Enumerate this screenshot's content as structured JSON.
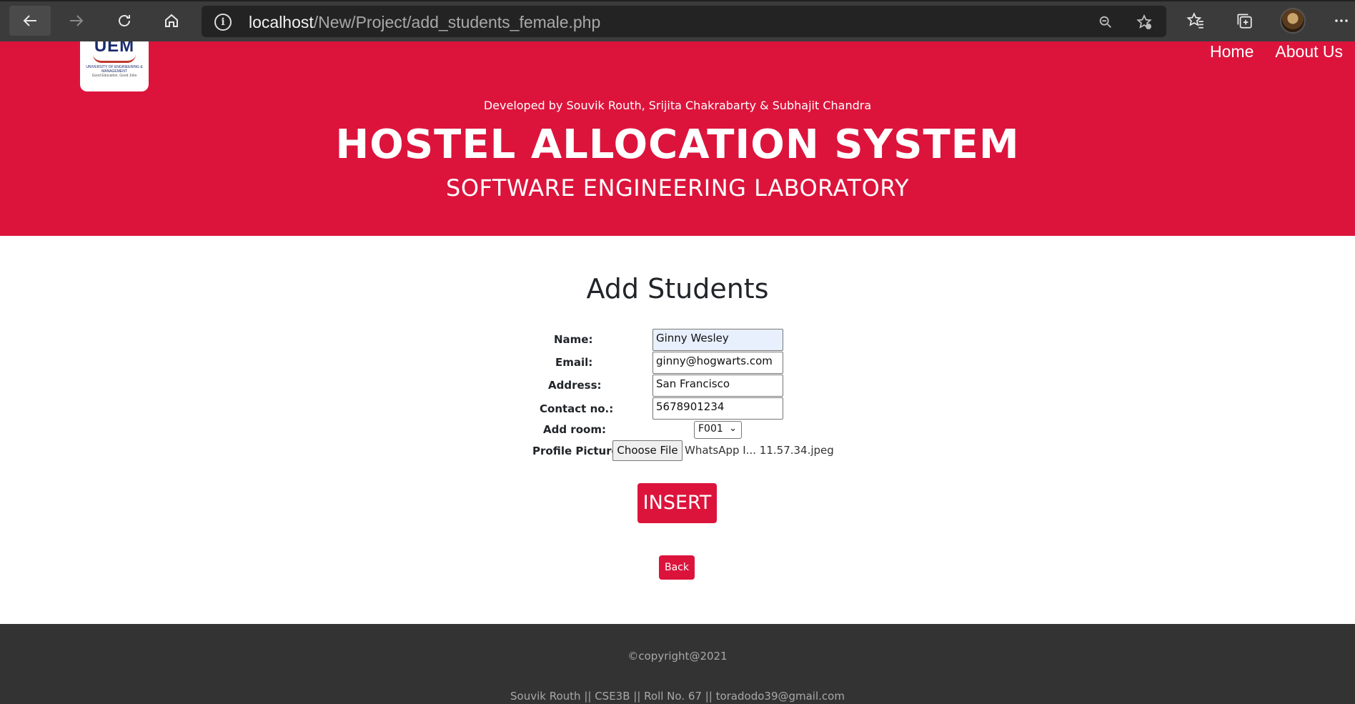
{
  "browser": {
    "url_host": "localhost",
    "url_path": "/New/Project/add_students_female.php",
    "icons": [
      "back-arrow-icon",
      "forward-arrow-icon",
      "reload-icon",
      "home-icon",
      "info-icon",
      "zoom-out-icon",
      "add-favorite-icon",
      "favorites-icon",
      "collections-icon",
      "profile-avatar",
      "more-icon"
    ]
  },
  "header": {
    "logo_text": "UEM",
    "logo_line1": "UNIVERSITY OF ENGINEERING & MANAGEMENT",
    "logo_line2": "Good Education, Good Jobs",
    "nav": [
      "Home",
      "About Us"
    ],
    "developed_by": "Developed by Souvik Routh, Srijita Chakrabarty & Subhajit Chandra",
    "title": "HOSTEL ALLOCATION SYSTEM",
    "subtitle": "SOFTWARE ENGINEERING LABORATORY",
    "background_color": "#dc143c"
  },
  "form": {
    "heading": "Add Students",
    "name_label": "Name:",
    "name_value": "Ginny Wesley",
    "email_label": "Email:",
    "email_value": "ginny@hogwarts.com",
    "address_label": "Address:",
    "address_value": "San Francisco",
    "contact_label": "Contact no.:",
    "contact_value": "5678901234",
    "room_label": "Add room:",
    "room_value": "F001",
    "picture_label": "Profile Picture:",
    "choose_file_label": "Choose File",
    "file_name": "WhatsApp I... 11.57.34.jpeg",
    "insert_label": "INSERT",
    "back_label": "Back",
    "accent_color": "#dc143c"
  },
  "footer": {
    "copyright": "©copyright@2021",
    "credits": "Souvik Routh || CSE3B || Roll No. 67 || toradodo39@gmail.com"
  }
}
